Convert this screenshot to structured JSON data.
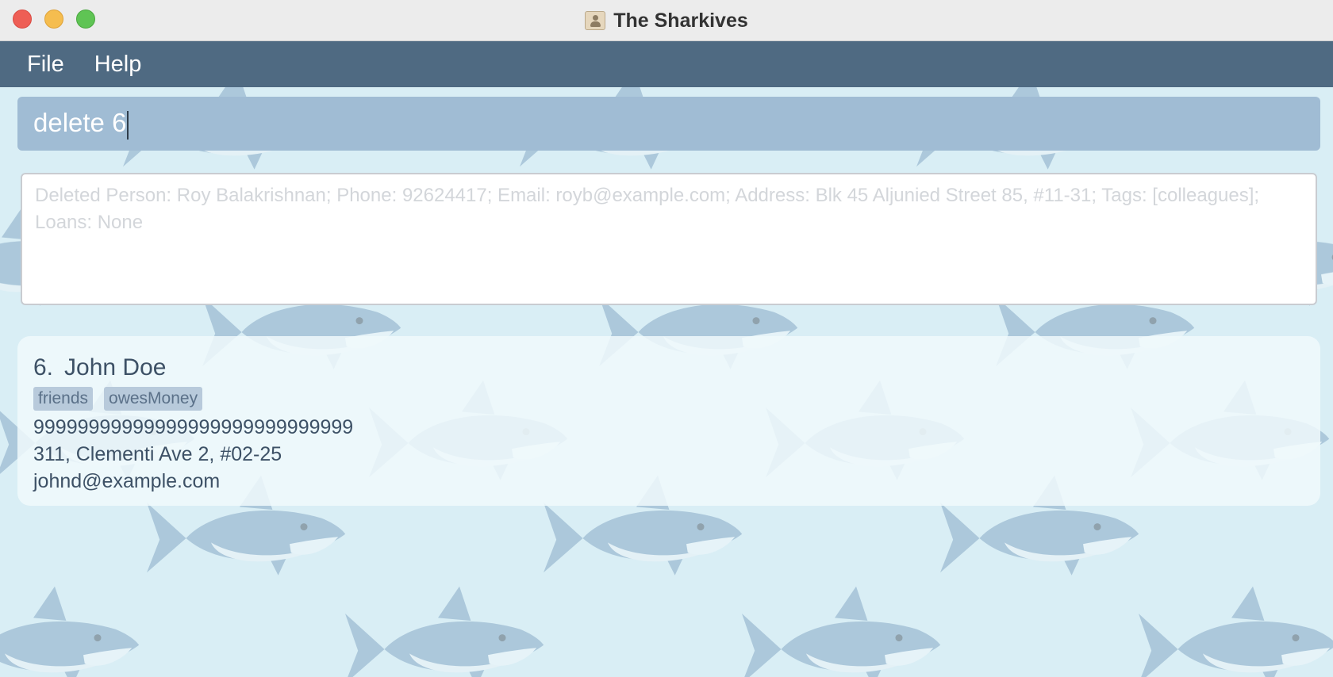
{
  "window": {
    "title": "The Sharkives"
  },
  "menu": {
    "items": [
      "File",
      "Help"
    ]
  },
  "command": {
    "value": "delete 6"
  },
  "result": {
    "text": "Deleted Person: Roy Balakrishnan; Phone: 92624417; Email: royb@example.com; Address: Blk 45 Aljunied Street 85, #11-31; Tags: [colleagues]; Loans: None"
  },
  "persons": [
    {
      "index": "6.",
      "name": "John Doe",
      "tags": [
        "friends",
        "owesMoney"
      ],
      "phone": "99999999999999999999999999999",
      "address": "311, Clementi Ave 2, #02-25",
      "email": "johnd@example.com"
    }
  ],
  "colors": {
    "menubar": "#4f6a82",
    "command_box": "#a0bcd4",
    "background": "#d9eef5",
    "tag": "#b8cadb",
    "text": "#3d5166"
  }
}
